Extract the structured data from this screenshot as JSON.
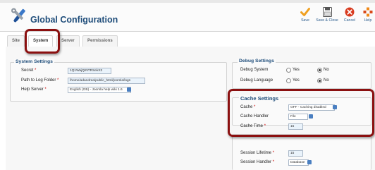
{
  "toolbar": {
    "title": "Global Configuration",
    "buttons": [
      {
        "label": "Save"
      },
      {
        "label": "Save & Close"
      },
      {
        "label": "Cancel"
      },
      {
        "label": "Help"
      }
    ]
  },
  "tabs": [
    "Site",
    "System",
    "Server",
    "Permissions"
  ],
  "system_settings": {
    "legend": "System Settings",
    "secret_label": "Secret",
    "secret_value": "1Q1WajQINTRSekX2",
    "log_label": "Path to Log Folder",
    "log_value": "/home/adandrea/public_html/joomla/logs",
    "help_label": "Help Server",
    "help_value": "English (GB) - Joomla help wiki 1.6"
  },
  "debug_settings": {
    "legend": "Debug Settings",
    "system_label": "Debug System",
    "language_label": "Debug Language",
    "yes": "Yes",
    "no": "No"
  },
  "cache_settings": {
    "legend": "Cache Settings",
    "cache_label": "Cache",
    "cache_value": "OFF - Caching disabled",
    "handler_label": "Cache Handler",
    "handler_value": "File",
    "time_label": "Cache Time",
    "time_value": "15"
  },
  "session_settings": {
    "lifetime_label": "Session Lifetime",
    "lifetime_value": "15",
    "handler_label": "Session Handler",
    "handler_value": "Database"
  },
  "colors": {
    "title": "#1f4d7a",
    "highlight": "#8b1010",
    "save_icon": "#f0a020",
    "cancel_icon": "#d83a1e",
    "help_icon": "#f08a1a"
  }
}
